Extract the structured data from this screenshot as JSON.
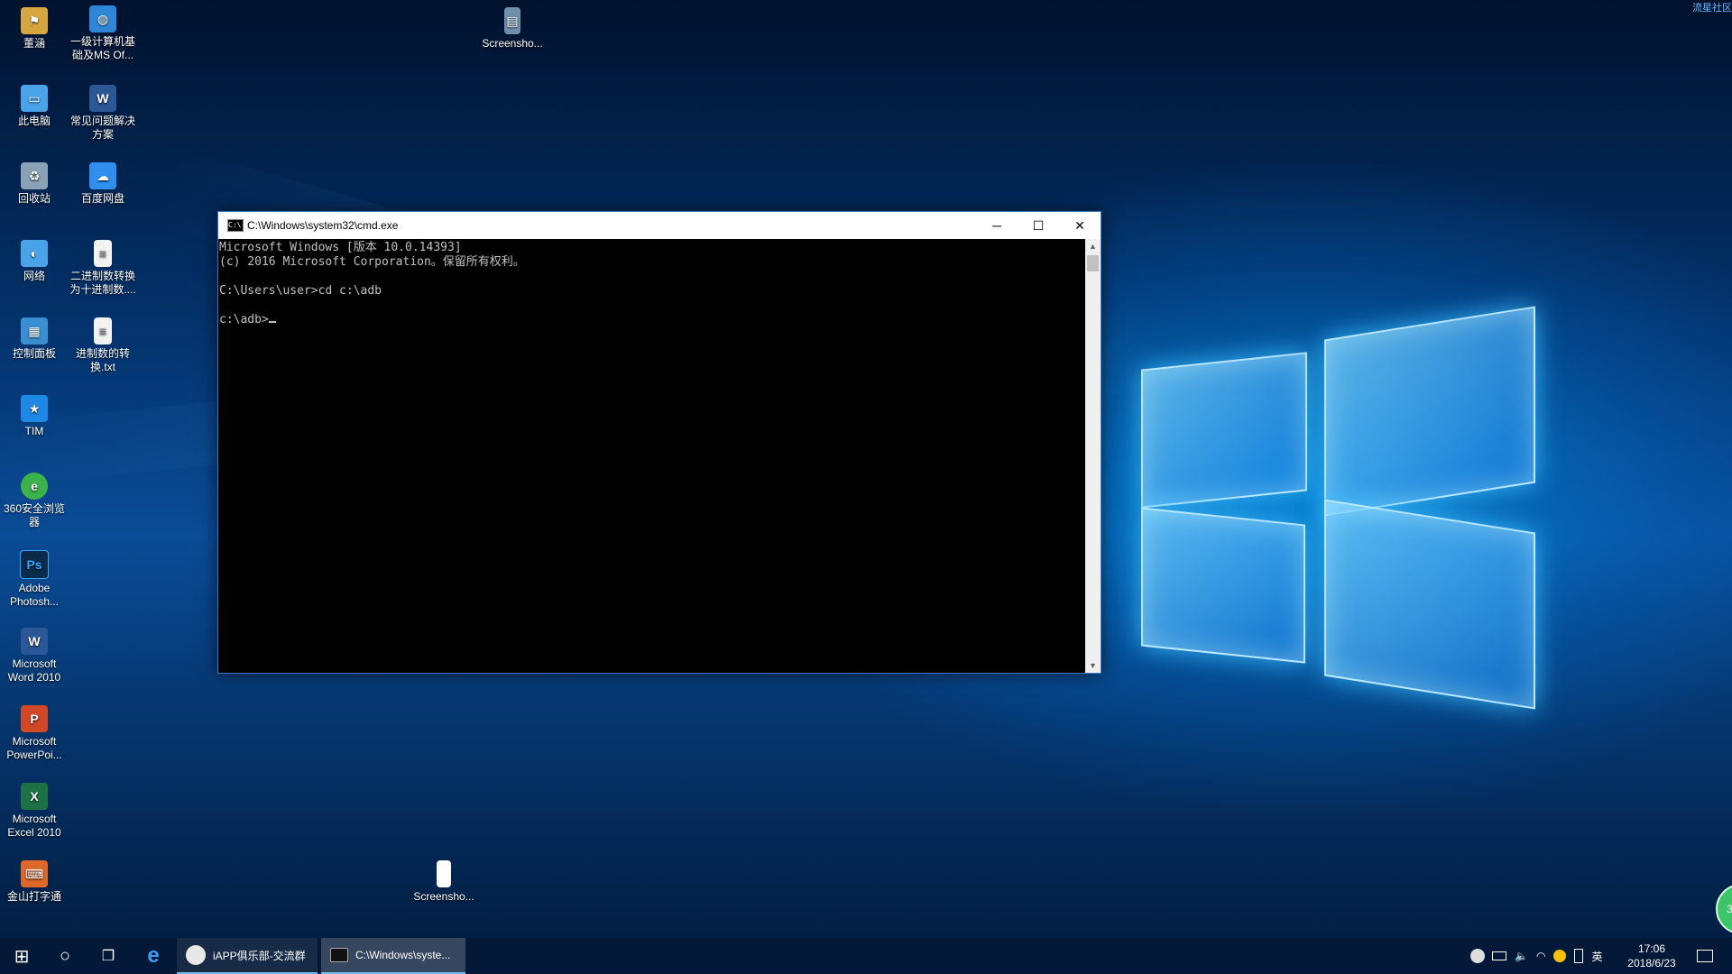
{
  "desktop_icons": [
    {
      "label": "董涵",
      "icon": "user-folder-icon",
      "color": "#d8a640"
    },
    {
      "label": "一级计算机基础及MS Of...",
      "icon": "globe-app-icon",
      "color": "#2e86d8"
    },
    {
      "label": "Screensho...",
      "icon": "image-file-icon",
      "color": "#6f8fae"
    },
    {
      "label": "此电脑",
      "icon": "computer-icon",
      "color": "#4aa3e8"
    },
    {
      "label": "常见问题解决方案",
      "icon": "word-doc-icon",
      "color": "#2b5797"
    },
    {
      "label": "回收站",
      "icon": "recycle-bin-icon",
      "color": "#8aa2b8"
    },
    {
      "label": "百度网盘",
      "icon": "baidu-netdisk-icon",
      "color": "#2f8ef0"
    },
    {
      "label": "网络",
      "icon": "network-icon",
      "color": "#4aa3e8"
    },
    {
      "label": "二进制数转换为十进制数....",
      "icon": "text-file-icon",
      "color": "#f2f2f2"
    },
    {
      "label": "控制面板",
      "icon": "control-panel-icon",
      "color": "#3a8fd0"
    },
    {
      "label": "进制数的转换.txt",
      "icon": "text-file-icon",
      "color": "#f2f2f2"
    },
    {
      "label": "TIM",
      "icon": "tim-icon",
      "color": "#1e88e5"
    },
    {
      "label": "360安全浏览器",
      "icon": "360-browser-icon",
      "color": "#3cb34a"
    },
    {
      "label": "Adobe Photosh...",
      "icon": "photoshop-icon",
      "color": "#0c2a4a"
    },
    {
      "label": "Microsoft Word 2010",
      "icon": "word-icon",
      "color": "#2b5797"
    },
    {
      "label": "Microsoft PowerPoi...",
      "icon": "powerpoint-icon",
      "color": "#d24726"
    },
    {
      "label": "Microsoft Excel 2010",
      "icon": "excel-icon",
      "color": "#1e7145"
    },
    {
      "label": "金山打字通",
      "icon": "kingsoft-typing-icon",
      "color": "#e0672a"
    },
    {
      "label": "Screensho...",
      "icon": "blank-file-icon",
      "color": "#ffffff"
    }
  ],
  "cmd": {
    "title": "C:\\Windows\\system32\\cmd.exe",
    "lines": [
      "Microsoft Windows [版本 10.0.14393]",
      "(c) 2016 Microsoft Corporation。保留所有权利。",
      "",
      "C:\\Users\\user>cd c:\\adb",
      "",
      "c:\\adb>"
    ],
    "minimize_glyph": "─",
    "maximize_glyph": "☐",
    "close_glyph": "✕"
  },
  "taskbar": {
    "start_glyph": "⊞",
    "search_glyph": "○",
    "taskview_glyph": "❐",
    "edge_glyph": "e",
    "apps": [
      {
        "label": "iAPP俱乐部-交流群",
        "icon": "chat-app-icon"
      },
      {
        "label": "C:\\Windows\\syste...",
        "icon": "cmd-icon"
      }
    ],
    "tray_ime": "英",
    "clock_time": "17:06",
    "clock_date": "2018/6/23"
  },
  "corner_text": "流星社区",
  "bubble_text": "38"
}
